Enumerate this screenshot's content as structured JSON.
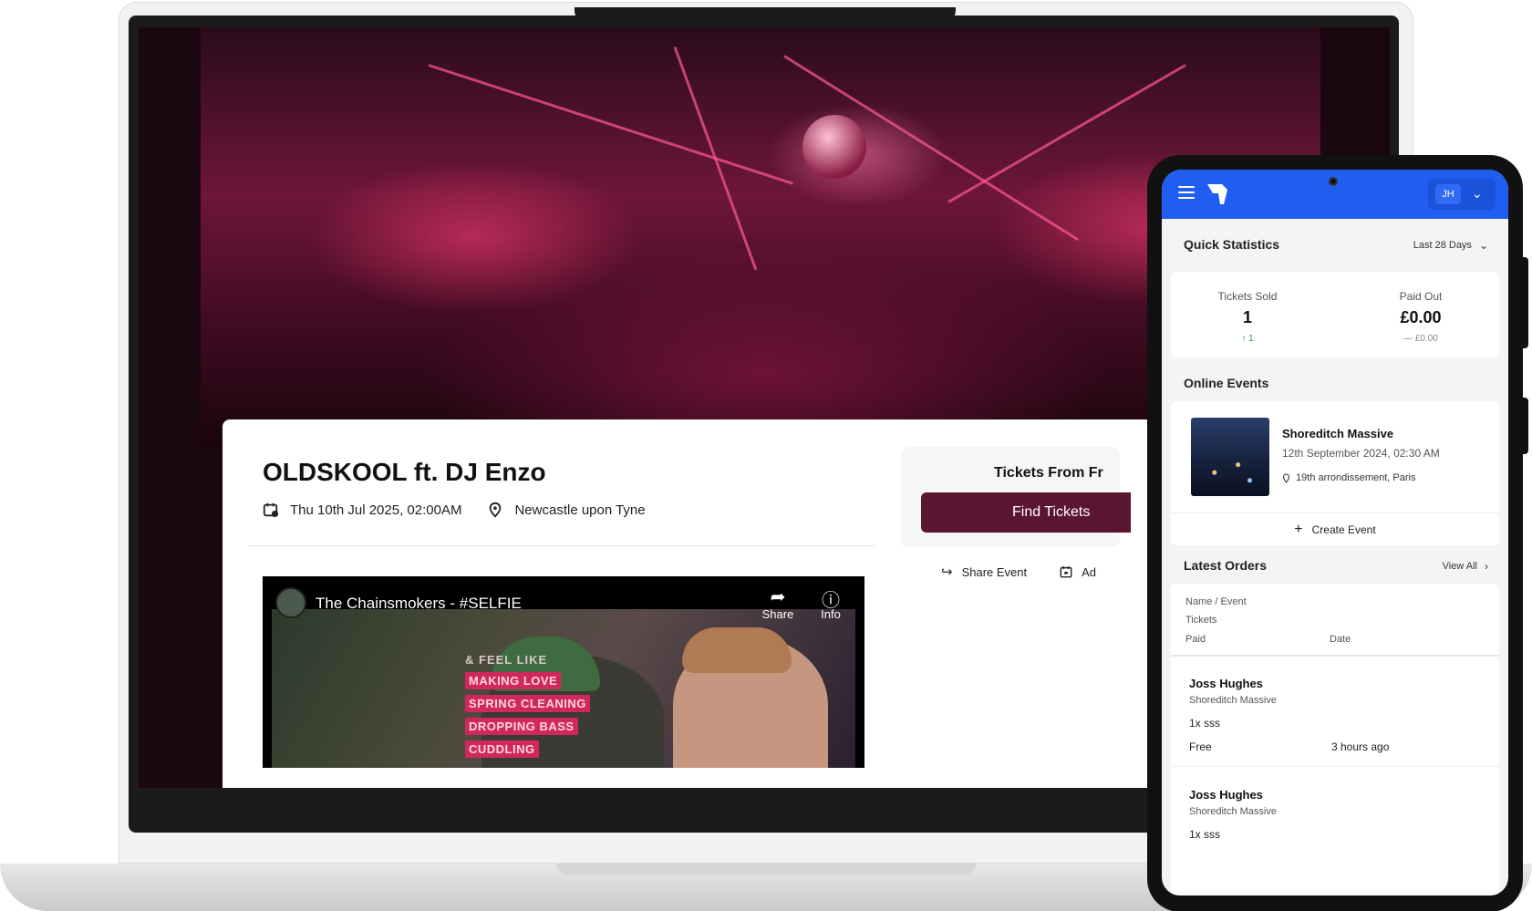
{
  "event_page": {
    "title": "OLDSKOOL ft. DJ Enzo",
    "date": "Thu 10th Jul 2025, 02:00AM",
    "location": "Newcastle upon Tyne",
    "tickets_from": "Tickets From Fr",
    "find_tickets": "Find Tickets",
    "share_event": "Share Event",
    "add_calendar": "Ad",
    "video": {
      "title": "The Chainsmokers - #SELFIE",
      "share": "Share",
      "info": "Info",
      "lyric_head": "& FEEL LIKE",
      "lyrics": [
        "MAKING LOVE",
        "SPRING CLEANING",
        "DROPPING BASS",
        "CUDDLING"
      ]
    }
  },
  "dashboard": {
    "user_initials": "JH",
    "quick_stats": {
      "title": "Quick Statistics",
      "range": "Last 28 Days",
      "tickets_sold_label": "Tickets Sold",
      "tickets_sold_value": "1",
      "tickets_sold_delta": "↑ 1",
      "paid_out_label": "Paid Out",
      "paid_out_value": "£0.00",
      "paid_out_delta": "— £0.00"
    },
    "online_events": {
      "title": "Online Events",
      "event_name": "Shoreditch Massive",
      "event_date": "12th September 2024, 02:30 AM",
      "event_location": "19th arrondissement, Paris",
      "create_event": "Create Event"
    },
    "latest_orders": {
      "title": "Latest Orders",
      "view_all": "View All",
      "headers": {
        "name_event": "Name / Event",
        "tickets": "Tickets",
        "paid": "Paid",
        "date": "Date"
      },
      "orders": [
        {
          "name": "Joss Hughes",
          "event": "Shoreditch Massive",
          "tickets": "1x sss",
          "paid": "Free",
          "date": "3 hours ago"
        },
        {
          "name": "Joss Hughes",
          "event": "Shoreditch Massive",
          "tickets": "1x sss"
        }
      ]
    }
  },
  "colors": {
    "brand_primary": "#5a1532",
    "dashboard_blue": "#1f5ef0",
    "positive": "#22a447"
  }
}
